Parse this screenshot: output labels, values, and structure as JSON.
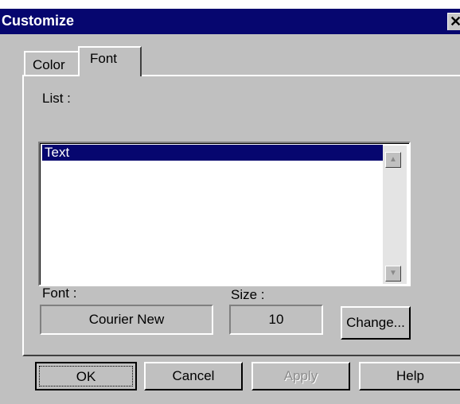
{
  "dialog": {
    "title": "Customize",
    "close_glyph": "✕",
    "close_icon": "close-icon"
  },
  "tabs": [
    {
      "label": "Color",
      "active": false
    },
    {
      "label": "Font",
      "active": true
    }
  ],
  "font_tab": {
    "list_label": "List :",
    "list_items": [
      "Text"
    ],
    "selected_item": "Text",
    "font_label": "Font :",
    "font_value": "Courier New",
    "size_label": "Size :",
    "size_value": "10",
    "change_button": "Change..."
  },
  "buttons": {
    "ok": "OK",
    "cancel": "Cancel",
    "apply": "Apply",
    "apply_enabled": false,
    "help": "Help"
  },
  "colors": {
    "titlebar": "#06066f",
    "selection": "#06066f",
    "face": "#c0c0c0"
  }
}
